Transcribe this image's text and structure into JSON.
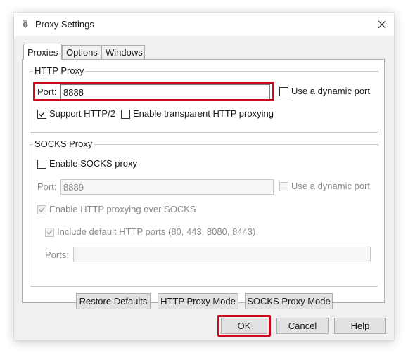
{
  "window": {
    "title": "Proxy Settings",
    "app_icon": "fiddler-icon",
    "close_icon": "close-icon"
  },
  "tabs": [
    {
      "label": "Proxies",
      "active": true
    },
    {
      "label": "Options",
      "active": false
    },
    {
      "label": "Windows",
      "active": false
    }
  ],
  "http_proxy": {
    "group_label": "HTTP Proxy",
    "port_label": "Port:",
    "port_value": "8888",
    "dynamic_port_label": "Use a dynamic port",
    "dynamic_port_checked": false,
    "http2_label": "Support HTTP/2",
    "http2_checked": true,
    "transparent_label": "Enable transparent HTTP proxying",
    "transparent_checked": false
  },
  "socks_proxy": {
    "group_label": "SOCKS Proxy",
    "enable_label": "Enable SOCKS proxy",
    "enable_checked": false,
    "port_label": "Port:",
    "port_value": "8889",
    "dynamic_port_label": "Use a dynamic port",
    "http_over_socks_label": "Enable HTTP proxying over SOCKS",
    "http_over_socks_checked": true,
    "default_ports_label": "Include default HTTP ports (80, 443, 8080, 8443)",
    "default_ports_checked": true,
    "ports_label": "Ports:",
    "ports_value": ""
  },
  "panel_buttons": {
    "restore": "Restore Defaults",
    "http_mode": "HTTP Proxy Mode",
    "socks_mode": "SOCKS Proxy Mode"
  },
  "dialog_buttons": {
    "ok": "OK",
    "cancel": "Cancel",
    "help": "Help"
  },
  "colors": {
    "highlight": "#cc0a1e",
    "dialog_bg": "#f0f0f0",
    "panel_bg": "#ffffff"
  }
}
